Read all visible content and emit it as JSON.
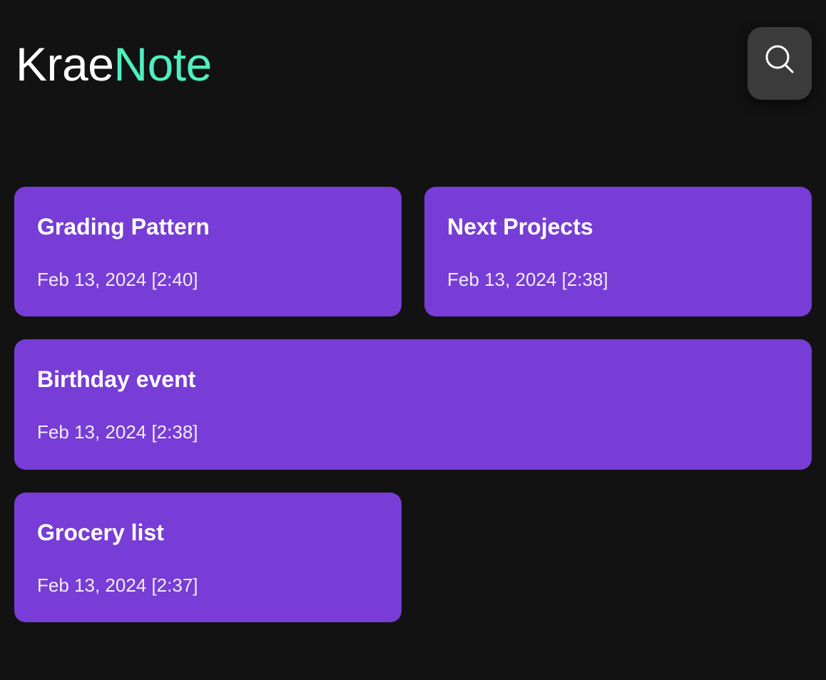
{
  "app": {
    "logo_part_1": "Krae",
    "logo_part_2": "Note",
    "accent_color": "#4ef0bf",
    "background_color": "#121212"
  },
  "toolbar": {
    "search_icon": "search-icon",
    "search_button_color": "#3b3b3b"
  },
  "notes": [
    {
      "title": "Grading Pattern",
      "date": "Feb 13, 2024 [2:40]"
    },
    {
      "title": "Next Projects",
      "date": "Feb 13, 2024 [2:38]"
    },
    {
      "title": "Birthday event",
      "date": "Feb 13, 2024 [2:38]"
    },
    {
      "title": "Grocery list",
      "date": "Feb 13, 2024 [2:37]"
    }
  ],
  "card_color": "#773dd6"
}
